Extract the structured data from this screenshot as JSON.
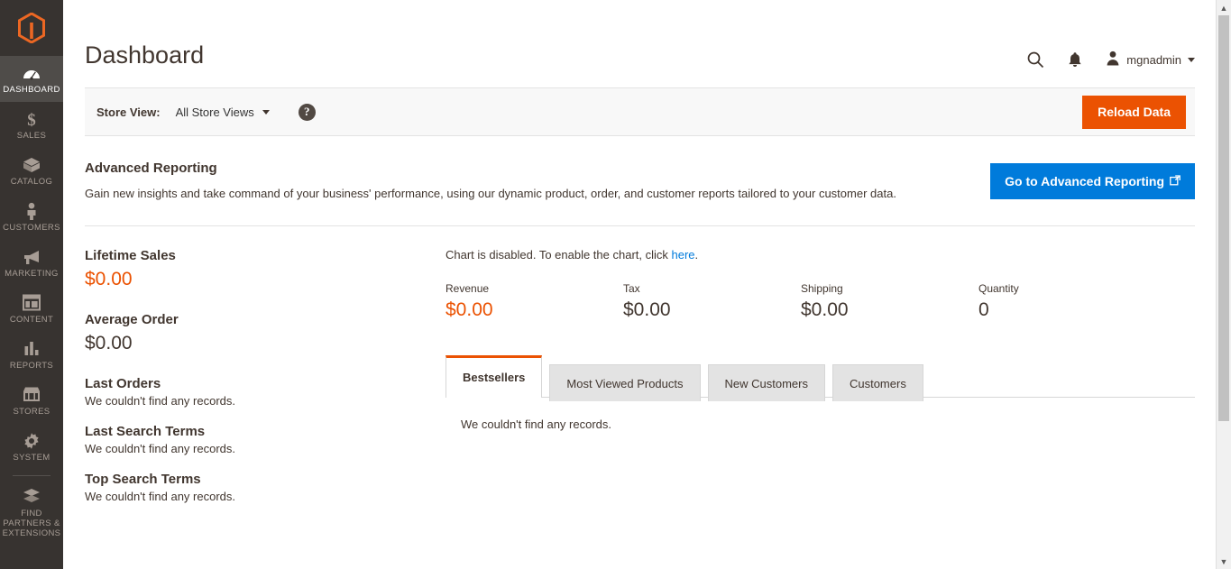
{
  "sidebar": {
    "logo_name": "magento-logo",
    "items": [
      {
        "label": "DASHBOARD",
        "icon": "dashboard-gauge-icon",
        "active": true
      },
      {
        "label": "SALES",
        "icon": "dollar-icon",
        "active": false
      },
      {
        "label": "CATALOG",
        "icon": "box-icon",
        "active": false
      },
      {
        "label": "CUSTOMERS",
        "icon": "person-icon",
        "active": false
      },
      {
        "label": "MARKETING",
        "icon": "megaphone-icon",
        "active": false
      },
      {
        "label": "CONTENT",
        "icon": "layout-icon",
        "active": false
      },
      {
        "label": "REPORTS",
        "icon": "bar-chart-icon",
        "active": false
      },
      {
        "label": "STORES",
        "icon": "storefront-icon",
        "active": false
      },
      {
        "label": "SYSTEM",
        "icon": "gear-icon",
        "active": false
      },
      {
        "label": "FIND PARTNERS & EXTENSIONS",
        "icon": "extensions-icon",
        "active": false
      }
    ]
  },
  "header": {
    "title": "Dashboard",
    "search_icon": "search-icon",
    "notifications_icon": "bell-icon",
    "user_name": "mgnadmin"
  },
  "storeview": {
    "label": "Store View:",
    "selected": "All Store Views",
    "help_glyph": "?",
    "reload_label": "Reload Data"
  },
  "advanced_reporting": {
    "title": "Advanced Reporting",
    "description": "Gain new insights and take command of your business' performance, using our dynamic product, order, and customer reports tailored to your customer data.",
    "button_label": "Go to Advanced Reporting"
  },
  "stats": [
    {
      "title": "Lifetime Sales",
      "value": "$0.00",
      "accent": true
    },
    {
      "title": "Average Order",
      "value": "$0.00",
      "accent": false
    }
  ],
  "lists": [
    {
      "title": "Last Orders",
      "empty": "We couldn't find any records."
    },
    {
      "title": "Last Search Terms",
      "empty": "We couldn't find any records."
    },
    {
      "title": "Top Search Terms",
      "empty": "We couldn't find any records."
    }
  ],
  "chart": {
    "disabled_prefix": "Chart is disabled. To enable the chart, click ",
    "enable_link": "here",
    "disabled_suffix": "."
  },
  "kpis": [
    {
      "label": "Revenue",
      "value": "$0.00",
      "accent": true
    },
    {
      "label": "Tax",
      "value": "$0.00",
      "accent": false
    },
    {
      "label": "Shipping",
      "value": "$0.00",
      "accent": false
    },
    {
      "label": "Quantity",
      "value": "0",
      "accent": false
    }
  ],
  "tabs": [
    {
      "label": "Bestsellers",
      "active": true
    },
    {
      "label": "Most Viewed Products",
      "active": false
    },
    {
      "label": "New Customers",
      "active": false
    },
    {
      "label": "Customers",
      "active": false
    }
  ],
  "tab_panel": {
    "empty": "We couldn't find any records."
  },
  "colors": {
    "accent_orange": "#eb5202",
    "link_blue": "#007bdb",
    "sidebar_bg": "#373330",
    "sidebar_active": "#4f4c49",
    "text_dark": "#41362f"
  },
  "scrollbar": {
    "up_glyph": "▲",
    "down_glyph": "▼"
  }
}
